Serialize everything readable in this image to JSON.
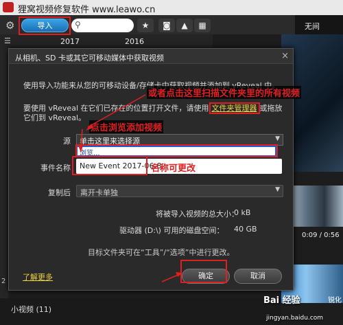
{
  "app": {
    "title": "狸窝视频修复软件 www.leawo.cn",
    "panel_title": "无间",
    "import_label": "导入",
    "timeline_years": [
      "2017",
      "2016"
    ],
    "time_readout": "0:09 / 0:56",
    "thumb_label": "锐化",
    "bottom_label": "小视频 (11)",
    "left_number": "2"
  },
  "dialog": {
    "title": "从相机、SD 卡或其它可移动媒体中获取视频",
    "intro": "使用导入功能来从您的可移动设备/存储卡中获取视频并添加到 vReveal 中。",
    "open_prefix": "要使用 vReveal 在它们已存在的位置打开文件，请使用",
    "open_link": "文件夹管理器",
    "open_suffix": "或拖放它们到 vReveal。",
    "source_label": "源",
    "source_value": "单击这里来选择源",
    "dropdown_option": "浏览...",
    "event_label": "事件名称",
    "event_value": "New Event 2017-06-8",
    "after_label": "复制后",
    "after_value": "离开卡单独",
    "total_size_label": "将被导入视频的总大小：",
    "total_size_value": "0 kB",
    "disk_label": "驱动器 (D:\\) 可用的磁盘空间：",
    "disk_value": "40 GB",
    "note": "目标文件夹可在“工具”/“选项”中进行更改。",
    "learn_more": "了解更多",
    "ok_label": "确定",
    "cancel_label": "取消"
  },
  "annotations": {
    "scan_folder": "或者点击这里扫描文件夹里的所有视频",
    "browse": "点击浏览添加视频",
    "rename": "名称可更改"
  },
  "watermark": {
    "main": "Bai 经验",
    "sub": "jingyan.baidu.com"
  },
  "colors": {
    "accent_blue": "#1b6fb0",
    "annotation_red": "#e02020",
    "link_yellow": "#f0d23c"
  }
}
